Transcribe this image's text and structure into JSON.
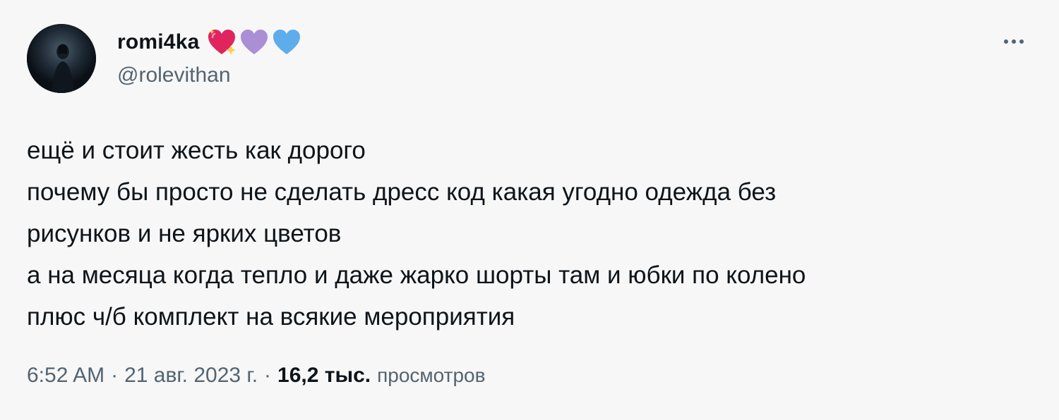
{
  "author": {
    "display_name": "romi4ka",
    "handle": "@rolevithan",
    "badges": [
      {
        "icon": "sparkling-heart-icon",
        "color": "#e0245e"
      },
      {
        "icon": "purple-heart-icon",
        "color": "#aa8ed6"
      },
      {
        "icon": "blue-heart-icon",
        "color": "#5dadec"
      }
    ]
  },
  "tweet": {
    "lines": [
      "ещё и стоит жесть как дорого",
      "почему бы просто не сделать дресс код какая угодно одежда без",
      "рисунков и не ярких цветов",
      "а на месяца когда тепло и даже жарко шорты там и юбки по колено",
      "плюс ч/б комплект на всякие мероприятия"
    ]
  },
  "meta": {
    "time": "6:52 AM",
    "separator": "·",
    "date": "21 авг. 2023 г.",
    "views_count": "16,2 тыс.",
    "views_label": "просмотров"
  },
  "colors": {
    "background": "#f7f7f7",
    "text_primary": "#0f1419",
    "text_secondary": "#536471"
  }
}
